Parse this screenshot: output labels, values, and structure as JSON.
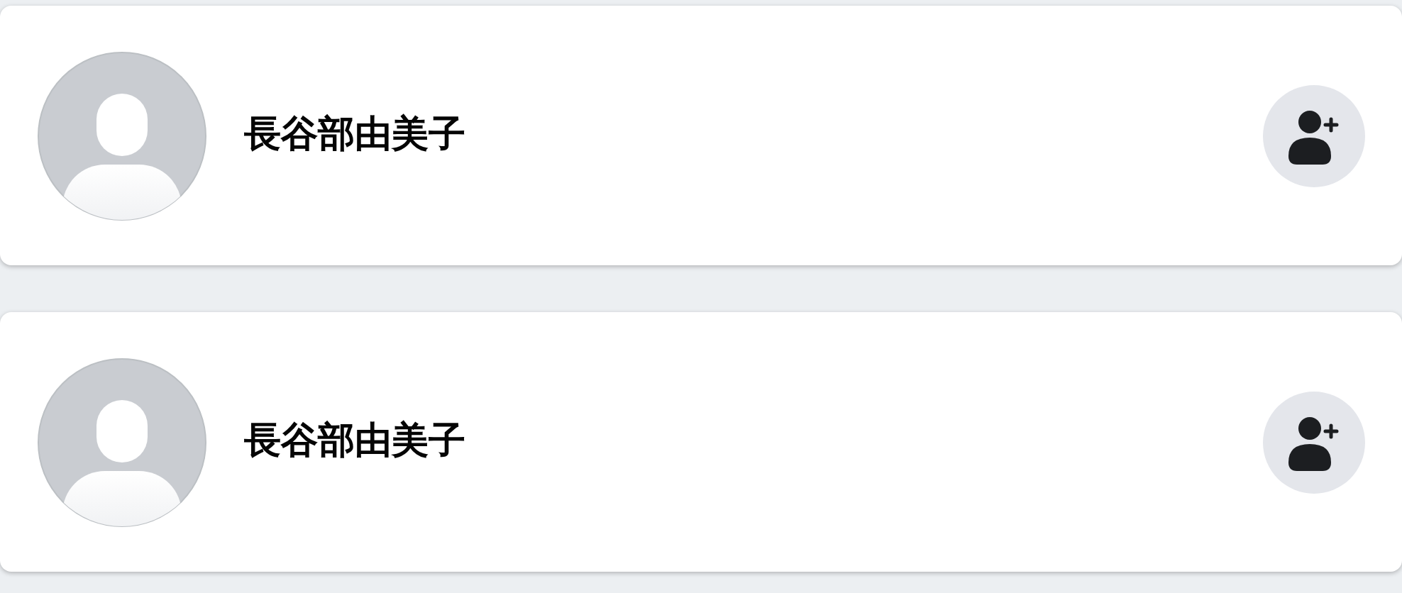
{
  "people": [
    {
      "name": "長谷部由美子"
    },
    {
      "name": "長谷部由美子"
    }
  ]
}
